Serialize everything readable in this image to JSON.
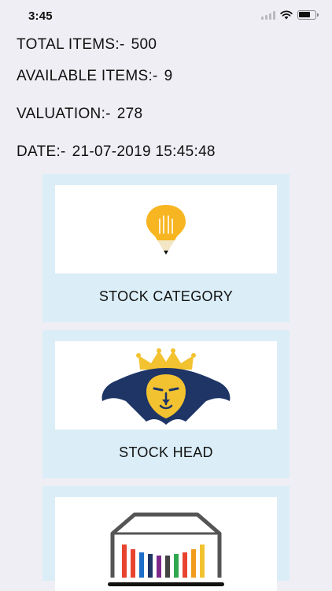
{
  "status_bar": {
    "time": "3:45"
  },
  "summary": {
    "total_items_label": "TOTAL ITEMS:-",
    "total_items_value": "500",
    "available_items_label": "AVAILABLE ITEMS:-",
    "available_items_value": "9",
    "valuation_label": "VALUATION:-",
    "valuation_value": "278",
    "date_label": "DATE:-",
    "date_value": "21-07-2019 15:45:48"
  },
  "cards": [
    {
      "label": "STOCK CATEGORY",
      "icon": "lightbulb-pencil-icon"
    },
    {
      "label": "STOCK HEAD",
      "icon": "lion-crown-icon"
    },
    {
      "label": "",
      "icon": "color-bars-box-icon"
    }
  ],
  "colors": {
    "background": "#eeeef4",
    "card_background": "#dbeef8",
    "bulb_yellow": "#f7b521",
    "lion_navy": "#1e3566",
    "lion_gold": "#f2c230"
  }
}
